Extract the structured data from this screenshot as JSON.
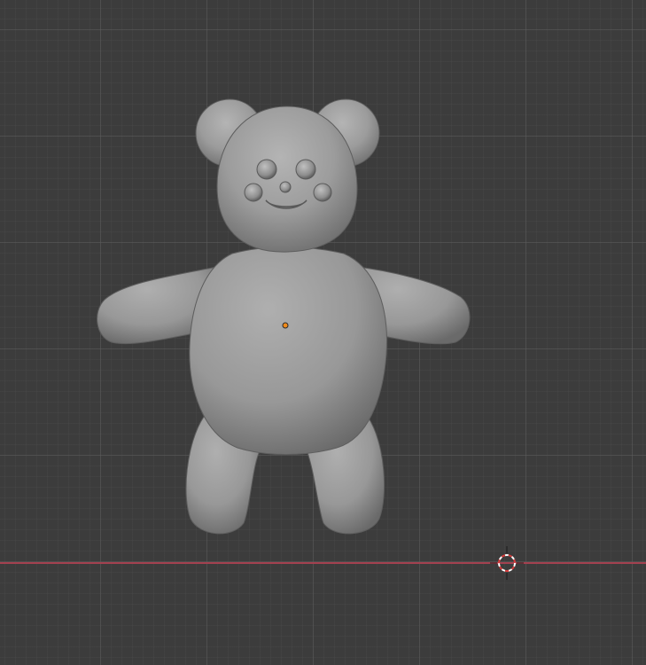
{
  "viewport": {
    "mode": "3d-viewport",
    "model": "bear-sculpt",
    "colors": {
      "background": "#3c3c3c",
      "grid_minor": "#464646",
      "grid_major": "#5a5a5a",
      "x_axis": "#a3414f",
      "mesh": "#9a9a9a",
      "origin": "#f08a1a",
      "cursor_red": "#d83b3b",
      "cursor_white": "#ffffff"
    }
  }
}
